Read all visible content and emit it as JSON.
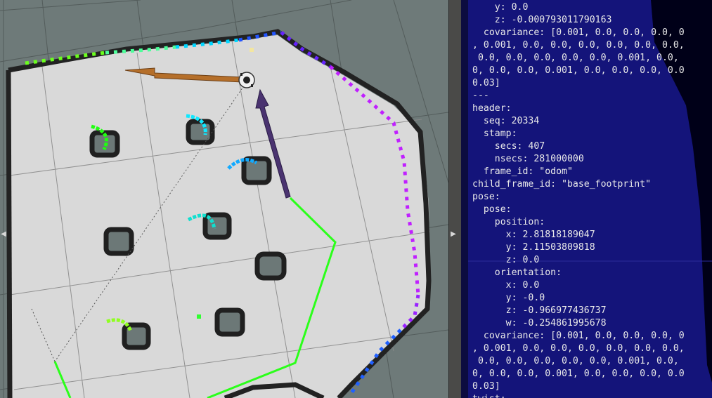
{
  "window": {
    "left_arrow": "◀",
    "right_arrow": "▶"
  },
  "rviz": {
    "colors": {
      "background": "#2f2f2f",
      "grid_floor": "#6e7a79",
      "free_space": "#d9d9d9",
      "walls": "#222222",
      "path": "#2bff1a",
      "pose_arrow_orange": "#b56f2a",
      "pose_arrow_purple": "#4a3370"
    },
    "icons": [
      "robot-icon",
      "pose-arrow-icon",
      "laser-scan-icon"
    ]
  },
  "terminal": {
    "lines": [
      "    y: 0.0",
      "    z: -0.000793011790163",
      "  covariance: [0.001, 0.0, 0.0, 0.0, 0",
      ", 0.001, 0.0, 0.0, 0.0, 0.0, 0.0, 0.0,",
      " 0.0, 0.0, 0.0, 0.0, 0.0, 0.001, 0.0, ",
      "0, 0.0, 0.0, 0.001, 0.0, 0.0, 0.0, 0.0",
      "0.03]",
      "---",
      "header:",
      "  seq: 20334",
      "  stamp:",
      "    secs: 407",
      "    nsecs: 281000000",
      "  frame_id: \"odom\"",
      "child_frame_id: \"base_footprint\"",
      "pose:",
      "  pose:",
      "    position:",
      "      x: 2.81818189047",
      "      y: 2.11503809818",
      "      z: 0.0",
      "    orientation:",
      "      x: 0.0",
      "      y: -0.0",
      "      z: -0.966977436737",
      "      w: -0.254861995678",
      "  covariance: [0.001, 0.0, 0.0, 0.0, 0",
      ", 0.001, 0.0, 0.0, 0.0, 0.0, 0.0, 0.0,",
      " 0.0, 0.0, 0.0, 0.0, 0.0, 0.001, 0.0, ",
      "0, 0.0, 0.0, 0.001, 0.0, 0.0, 0.0, 0.0",
      "0.03]",
      "twist:"
    ]
  }
}
